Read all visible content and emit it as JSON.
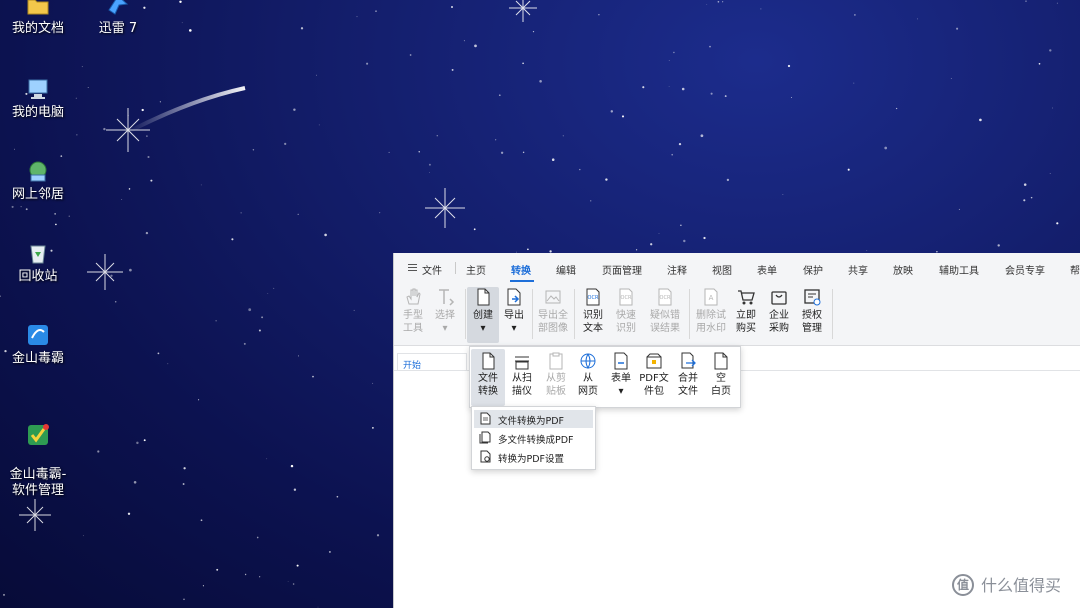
{
  "desktop": {
    "icons": [
      {
        "name": "my-documents",
        "label": "我的文档"
      },
      {
        "name": "xunlei",
        "label": "迅雷 7"
      },
      {
        "name": "my-computer",
        "label": "我的电脑"
      },
      {
        "name": "network-neighborhood",
        "label": "网上邻居"
      },
      {
        "name": "recycle-bin",
        "label": "回收站"
      },
      {
        "name": "kingsoft-antivirus",
        "label": "金山毒霸"
      },
      {
        "name": "kingsoft-software-manager",
        "label": "金山毒霸-\n软件管理"
      }
    ]
  },
  "app": {
    "menu": {
      "file": "文件",
      "tabs": [
        "主页",
        "转换",
        "编辑",
        "页面管理",
        "注释",
        "视图",
        "表单",
        "保护",
        "共享",
        "放映",
        "辅助工具",
        "会员专享",
        "帮"
      ],
      "active_tab": "转换"
    },
    "ribbon": {
      "hand_tool": "手型\n工具",
      "select": "选择",
      "create": "创建",
      "export": "导出",
      "export_all_images": "导出全\n部图像",
      "ocr_text": "识别\n文本",
      "quick_ocr": "快速\n识别",
      "suspect_results": "疑似错\n误结果",
      "remove_trial_watermark": "删除试\n用水印",
      "buy_now": "立即\n购买",
      "enterprise_purchase": "企业\n采购",
      "license_management": "授权\n管理"
    },
    "doc_tab": "开始",
    "create_menu": {
      "file_convert": "文件\n转换",
      "from_scanner": "从扫\n描仪",
      "from_clipboard": "从剪\n贴板",
      "from_webpage": "从\n网页",
      "form": "表单",
      "pdf_package": "PDF文\n件包",
      "merge_files": "合并\n文件",
      "blank_page": "空\n白页"
    },
    "sub_menu": {
      "items": [
        "文件转换为PDF",
        "多文件转换成PDF",
        "转换为PDF设置"
      ]
    }
  },
  "watermark": {
    "logo": "值",
    "text": "什么值得买"
  },
  "colors": {
    "accent": "#1e6fd9",
    "desktop_bg": "#101a5c"
  }
}
